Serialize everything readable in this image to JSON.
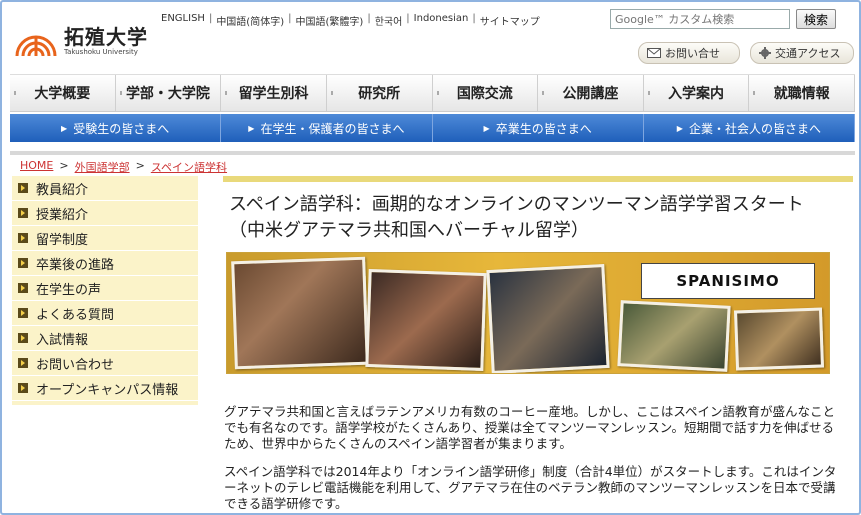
{
  "header": {
    "logo_name": "拓殖大学",
    "logo_sub": "Takushoku University",
    "languages": [
      "ENGLISH",
      "中国語(简体字)",
      "中国語(繁體字)",
      "한국어",
      "Indonesian",
      "サイトマップ"
    ],
    "search_placeholder": "Google™ カスタム検索",
    "search_button": "検索",
    "contact_label": "お問い合せ",
    "access_label": "交通アクセス"
  },
  "main_nav": [
    "大学概要",
    "学部・大学院",
    "留学生別科",
    "研究所",
    "国際交流",
    "公開講座",
    "入学案内",
    "就職情報"
  ],
  "sub_nav": [
    "受験生の皆さまへ",
    "在学生・保護者の皆さまへ",
    "卒業生の皆さまへ",
    "企業・社会人の皆さまへ"
  ],
  "breadcrumb": [
    "HOME",
    "外国語学部",
    "スペイン語学科"
  ],
  "sidebar": [
    "教員紹介",
    "授業紹介",
    "留学制度",
    "卒業後の進路",
    "在学生の声",
    "よくある質問",
    "入試情報",
    "お問い合わせ",
    "オープンキャンパス情報"
  ],
  "content": {
    "title": "スペイン語学科：画期的なオンラインのマンツーマン語学学習スタート（中米グアテマラ共和国へバーチャル留学）",
    "banner_logo": "SPANISIMO",
    "paragraph1": "グアテマラ共和国と言えばラテンアメリカ有数のコーヒー産地。しかし、ここはスペイン語教育が盛んなことでも有名なのです。語学学校がたくさんあり、授業は全てマンツーマンレッスン。短期間で話す力を伸ばせるため、世界中からたくさんのスペイン語学習者が集まります。",
    "paragraph2": "スペイン語学科では2014年より「オンライン語学研修」制度（合計4単位）がスタートします。これはインターネットのテレビ電話機能を利用して、グアテマラ在住のベテラン教師のマンツーマンレッスンを日本で受講できる語学研修です。"
  },
  "colors": {
    "accent_blue": "#1f5fba",
    "sidebar_bg": "#fbf3c9",
    "link_red": "#cc3333",
    "logo_orange": "#e8641c"
  }
}
